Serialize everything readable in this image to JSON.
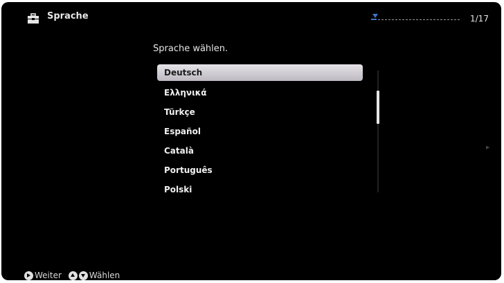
{
  "header": {
    "icon": "toolbox-icon",
    "title": "Sprache",
    "page_counter": "1/17",
    "progress_fraction": 0.06
  },
  "main": {
    "subtitle": "Sprache wählen.",
    "languages": [
      {
        "label": "Deutsch",
        "selected": true
      },
      {
        "label": "Ελληνικά",
        "selected": false
      },
      {
        "label": "Türkçe",
        "selected": false
      },
      {
        "label": "Español",
        "selected": false
      },
      {
        "label": "Català",
        "selected": false
      },
      {
        "label": "Português",
        "selected": false
      },
      {
        "label": "Polski",
        "selected": false
      }
    ]
  },
  "footer": {
    "next_label": "Weiter",
    "select_label": "Wählen"
  },
  "colors": {
    "background": "#000000",
    "accent": "#3f73c8",
    "highlight": "#d8d4da"
  }
}
